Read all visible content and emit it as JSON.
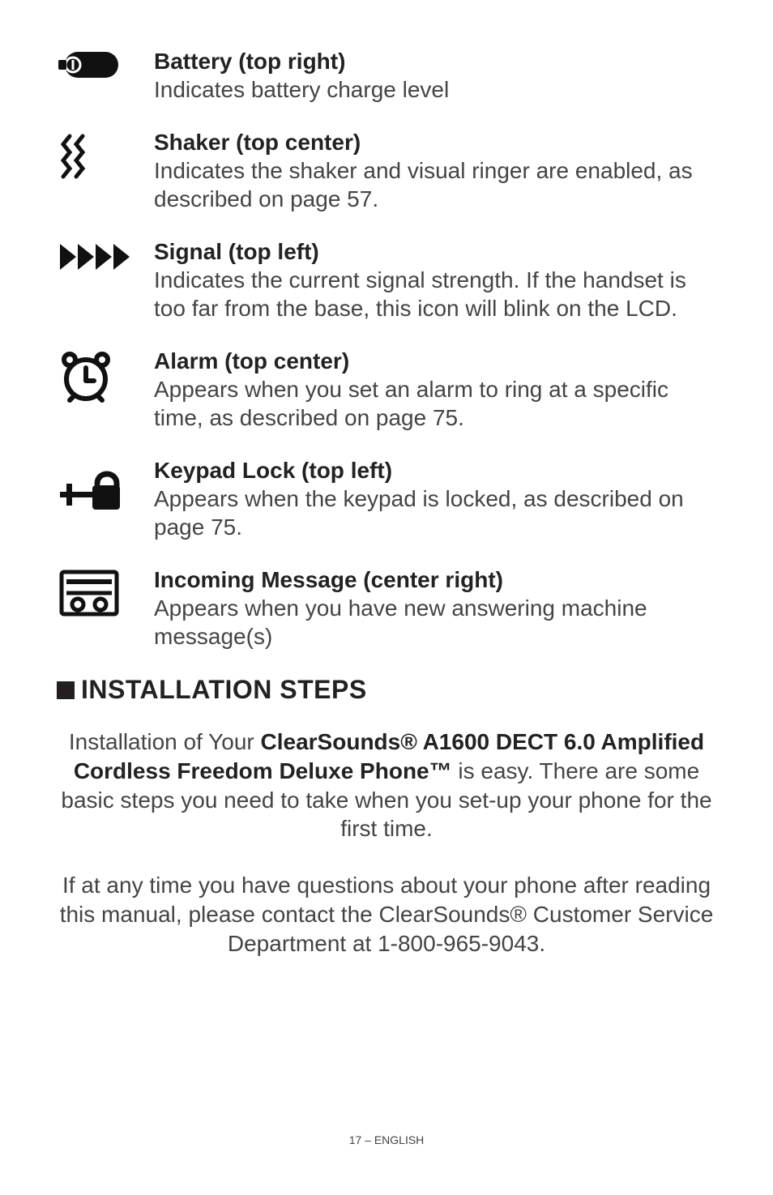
{
  "icons": [
    {
      "name": "battery-icon",
      "title": "Battery (top right)",
      "desc": "Indicates battery charge level"
    },
    {
      "name": "shaker-icon",
      "title": "Shaker (top center)",
      "desc": "Indicates the shaker and visual ringer are enabled, as described on page 57."
    },
    {
      "name": "signal-icon",
      "title": "Signal (top left)",
      "desc": "Indicates the current signal strength.  If the handset is too far from the base, this icon will blink on the LCD."
    },
    {
      "name": "alarm-icon",
      "title": "Alarm (top center)",
      "desc": "Appears when you set an alarm to ring at a specific time, as described on page 75."
    },
    {
      "name": "keypad-lock-icon",
      "title": "Keypad Lock (top left)",
      "desc": "Appears when the keypad is locked, as described on page 75."
    },
    {
      "name": "incoming-message-icon",
      "title": "Incoming Message (center right)",
      "desc": "Appears when you have new answering machine message(s)"
    }
  ],
  "section_heading": "INSTALLATION STEPS",
  "para1_lead": "Installation of Your ",
  "para1_bold": "ClearSounds® A1600 DECT 6.0 Amplified Cordless Freedom Deluxe Phone™",
  "para1_tail": " is easy. There are some basic steps you need to take when you set-up your phone for the first time.",
  "para2": "If at any time you have questions about your phone after reading this manual, please contact the ClearSounds® Customer Service Department at 1-800-965-9043.",
  "footer": "17 – ENGLISH"
}
